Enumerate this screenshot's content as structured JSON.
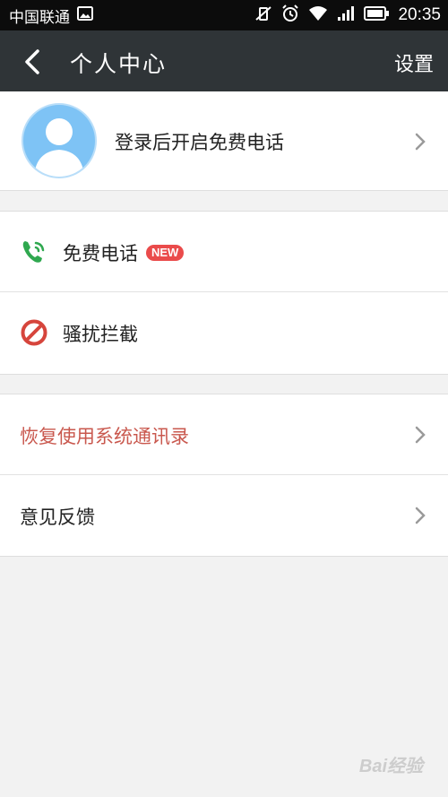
{
  "status_bar": {
    "carrier": "中国联通",
    "time": "20:35",
    "icons": [
      "image-icon",
      "mute-vibrate-icon",
      "alarm-icon",
      "wifi-icon",
      "signal-icon",
      "battery-icon"
    ]
  },
  "nav": {
    "title": "个人中心",
    "settings_label": "设置",
    "back_icon": "back-icon"
  },
  "profile": {
    "login_prompt": "登录后开启免费电话",
    "avatar_icon": "default-avatar-icon"
  },
  "section1": {
    "items": [
      {
        "label": "免费电话",
        "icon": "phone-icon",
        "badge": "NEW"
      },
      {
        "label": "骚扰拦截",
        "icon": "block-icon"
      }
    ]
  },
  "section2": {
    "items": [
      {
        "label": "恢复使用系统通讯录",
        "color": "#c9584e"
      },
      {
        "label": "意见反馈"
      }
    ]
  },
  "colors": {
    "status_bar_bg": "#0c0c0c",
    "nav_bg": "#2f3437",
    "accent_red": "#c9584e",
    "badge_red": "#ea4b4b",
    "phone_green": "#2fa84f",
    "avatar_blue": "#7ec3f5"
  },
  "watermark": "Bai经验"
}
